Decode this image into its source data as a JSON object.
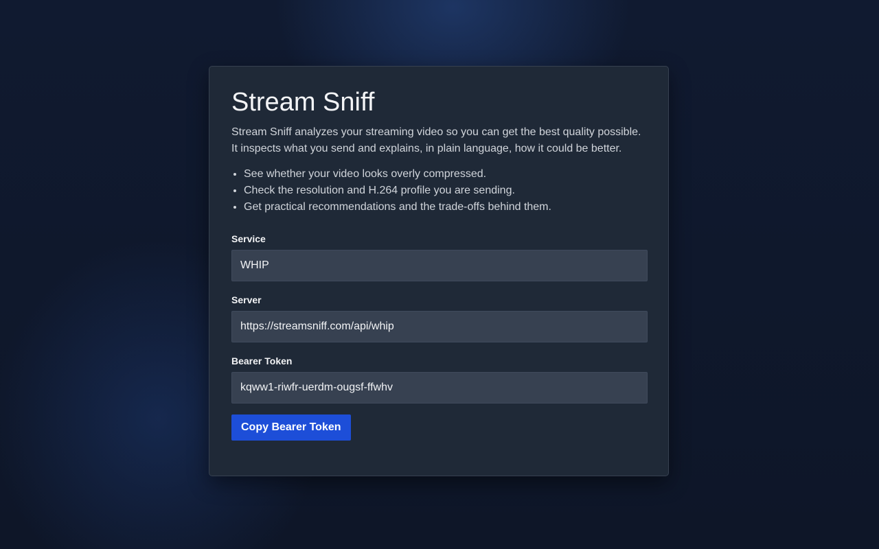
{
  "app": {
    "title": "Stream Sniff"
  },
  "intro": {
    "line1": "Stream Sniff analyzes your streaming video so you can get the best quality possible.",
    "line2": "It inspects what you send and explains, in plain language, how it could be better."
  },
  "features": [
    "See whether your video looks overly compressed.",
    "Check the resolution and H.264 profile you are sending.",
    "Get practical recommendations and the trade-offs behind them."
  ],
  "fields": {
    "service": {
      "label": "Service",
      "value": "WHIP"
    },
    "server": {
      "label": "Server",
      "value": "https://streamsniff.com/api/whip"
    },
    "bearer_token": {
      "label": "Bearer Token",
      "value": "kqww1-riwfr-uerdm-ougsf-ffwhv"
    }
  },
  "actions": {
    "copy_token_label": "Copy Bearer Token"
  },
  "colors": {
    "accent": "#1d4ed8",
    "card": "#1f2937",
    "field": "#374151",
    "background": "#0f1729"
  }
}
